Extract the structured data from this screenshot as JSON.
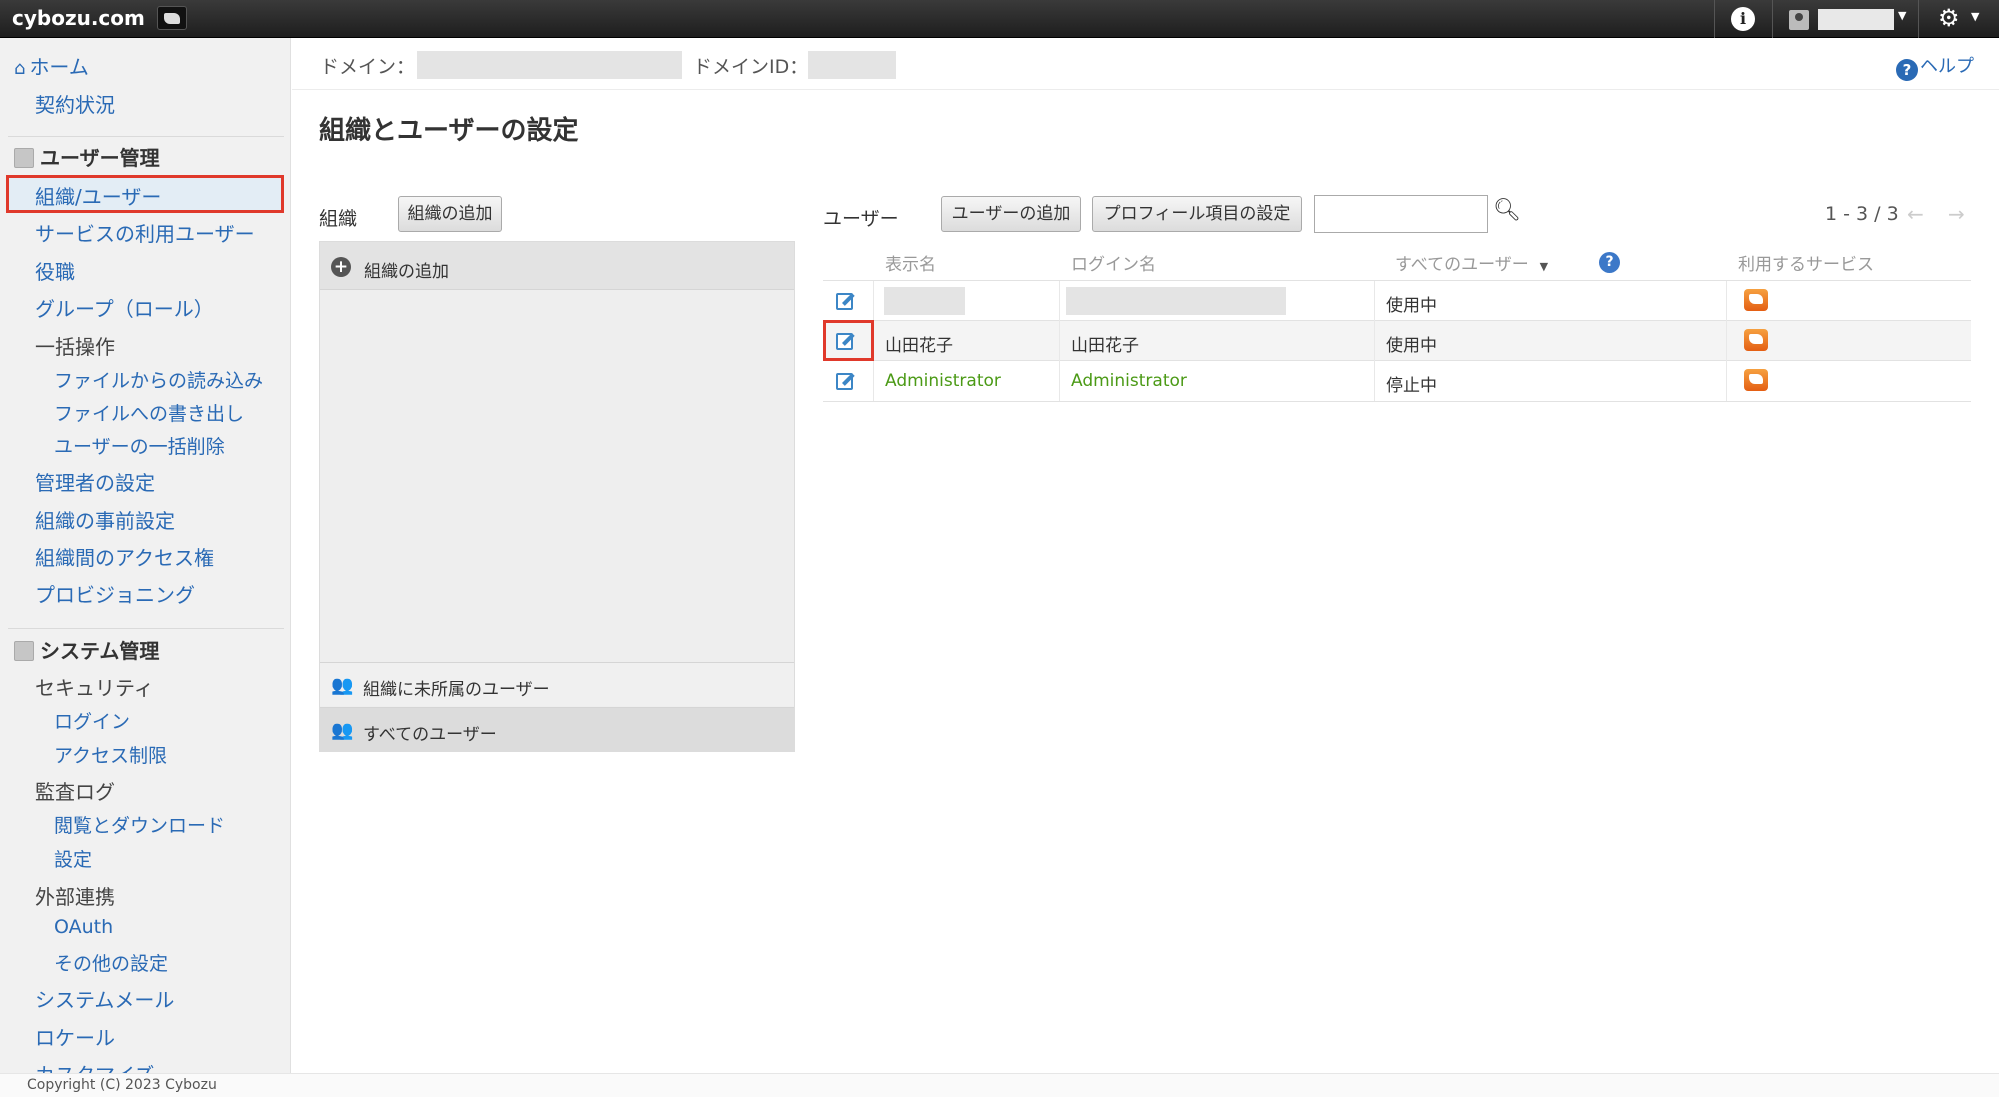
{
  "topbar": {
    "brand": "cybozu.com",
    "info_icon": "info-icon",
    "user_icon": "user-icon",
    "gear_icon": "gear-icon"
  },
  "sidebar": {
    "home": "ホーム",
    "contract": "契約状況",
    "user_mgmt_header": "ユーザー管理",
    "org_users": "組織/ユーザー",
    "service_users": "サービスの利用ユーザー",
    "roles": "役職",
    "groups": "グループ（ロール）",
    "bulk": "一括操作",
    "import": "ファイルからの読み込み",
    "export": "ファイルへの書き出し",
    "bulk_delete": "ユーザーの一括削除",
    "admin_settings": "管理者の設定",
    "org_presets": "組織の事前設定",
    "org_access": "組織間のアクセス権",
    "provisioning": "プロビジョニング",
    "system_header": "システム管理",
    "security": "セキュリティ",
    "login": "ログイン",
    "access_limit": "アクセス制限",
    "audit_log": "監査ログ",
    "view_download": "閲覧とダウンロード",
    "settings": "設定",
    "external": "外部連携",
    "oauth": "OAuth",
    "other_settings": "その他の設定",
    "system_mail": "システムメール",
    "locale": "ロケール",
    "customize": "カスタマイズ"
  },
  "header": {
    "domain_label": "ドメイン：",
    "domain_id_label": "ドメインID：",
    "help": "ヘルプ",
    "page_title": "組織とユーザーの設定"
  },
  "org_panel": {
    "label": "組織",
    "add_button": "組織の追加",
    "add_row": "組織の追加",
    "unassigned": "組織に未所属のユーザー",
    "all_users": "すべてのユーザー"
  },
  "user_panel": {
    "label": "ユーザー",
    "add_user_button": "ユーザーの追加",
    "profile_button": "プロフィール項目の設定",
    "search_placeholder": "",
    "pager": "1 - 3 / 3",
    "columns": {
      "display_name": "表示名",
      "login_name": "ログイン名",
      "filter": "すべてのユーザー",
      "services": "利用するサービス"
    },
    "rows": [
      {
        "display_name": "",
        "login_name": "",
        "status": "使用中"
      },
      {
        "display_name": "山田花子",
        "login_name": "山田花子",
        "status": "使用中"
      },
      {
        "display_name": "Administrator",
        "login_name": "Administrator",
        "status": "停止中"
      }
    ]
  },
  "footer": {
    "copyright": "Copyright (C) 2023 Cybozu"
  },
  "colors": {
    "link": "#2a6ab5",
    "highlight": "#e0392b",
    "disabled_user": "#4b9a16"
  }
}
